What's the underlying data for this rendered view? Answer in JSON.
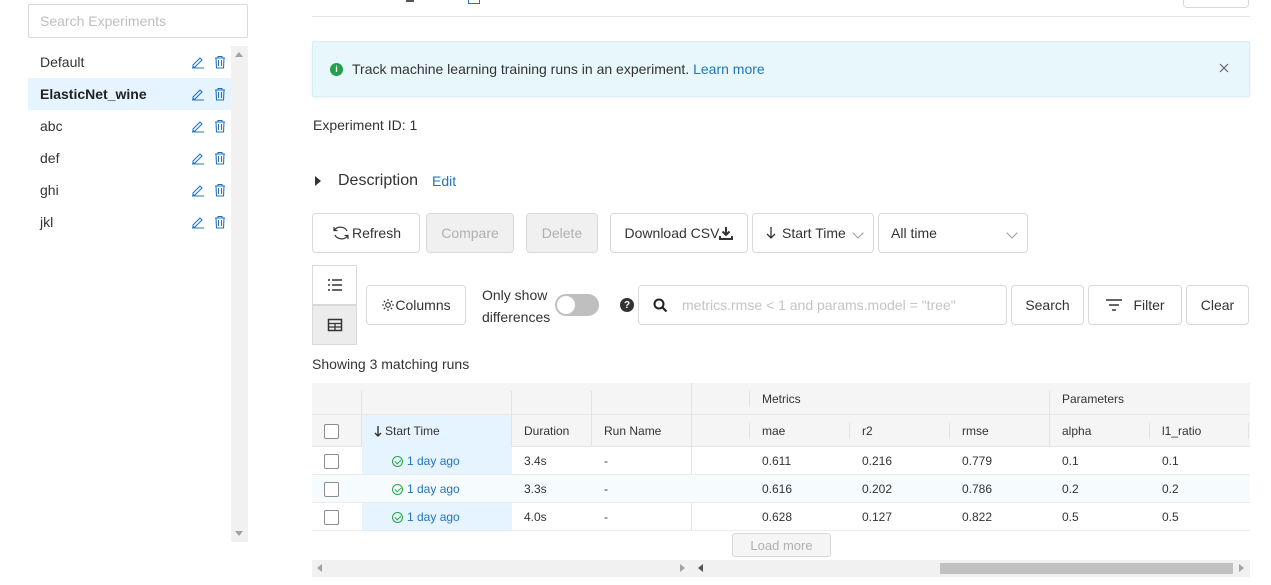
{
  "sidebar": {
    "search_placeholder": "Search Experiments",
    "experiments": [
      {
        "name": "Default",
        "active": false
      },
      {
        "name": "ElasticNet_wine",
        "active": true
      },
      {
        "name": "abc",
        "active": false
      },
      {
        "name": "def",
        "active": false
      },
      {
        "name": "ghi",
        "active": false
      },
      {
        "name": "jkl",
        "active": false
      }
    ],
    "icon_edit": "edit-pencil-icon",
    "icon_delete": "trash-icon"
  },
  "banner": {
    "text": "Track machine learning training runs in an experiment.",
    "link": "Learn more",
    "icon": "info-icon"
  },
  "experiment": {
    "id_label": "Experiment ID:",
    "id_value": "1"
  },
  "description": {
    "label": "Description",
    "edit": "Edit"
  },
  "toolbar": {
    "refresh": "Refresh",
    "compare": "Compare",
    "delete": "Delete",
    "download": "Download CSV",
    "sort_value": "Start Time",
    "time_value": "All time",
    "columns": "Columns",
    "only_show": "Only show differences",
    "search_placeholder": "metrics.rmse < 1 and params.model = \"tree\"",
    "search": "Search",
    "filter": "Filter",
    "clear": "Clear"
  },
  "runs": {
    "showing": "Showing 3 matching runs",
    "group_headers": {
      "metrics": "Metrics",
      "parameters": "Parameters"
    },
    "columns": [
      "Start Time",
      "Duration",
      "Run Name",
      "mae",
      "r2",
      "rmse",
      "alpha",
      "l1_ratio"
    ],
    "rows": [
      {
        "start": "1 day ago",
        "duration": "3.4s",
        "run_name": "-",
        "mae": "0.611",
        "r2": "0.216",
        "rmse": "0.779",
        "alpha": "0.1",
        "l1_ratio": "0.1"
      },
      {
        "start": "1 day ago",
        "duration": "3.3s",
        "run_name": "-",
        "mae": "0.616",
        "r2": "0.202",
        "rmse": "0.786",
        "alpha": "0.2",
        "l1_ratio": "0.2"
      },
      {
        "start": "1 day ago",
        "duration": "4.0s",
        "run_name": "-",
        "mae": "0.628",
        "r2": "0.127",
        "rmse": "0.822",
        "alpha": "0.5",
        "l1_ratio": "0.5"
      }
    ],
    "load_more": "Load more"
  },
  "colors": {
    "accent": "#2374bb",
    "banner_bg": "#e8f7fb",
    "selected_bg": "#e6f4ff",
    "success": "#28a745"
  }
}
